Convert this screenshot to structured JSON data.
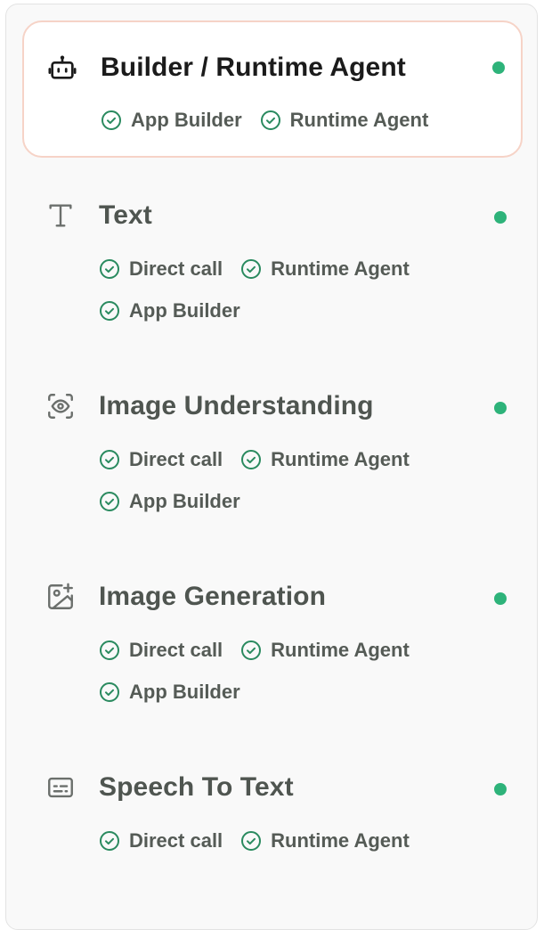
{
  "accent": "#2eb37a",
  "items": [
    {
      "title": "Builder / Runtime Agent",
      "icon": "robot-icon",
      "active": true,
      "tags": [
        "App Builder",
        "Runtime Agent"
      ]
    },
    {
      "title": "Text",
      "icon": "text-icon",
      "active": false,
      "tags": [
        "Direct call",
        "Runtime Agent",
        "App Builder"
      ]
    },
    {
      "title": "Image Understanding",
      "icon": "eye-scan-icon",
      "active": false,
      "tags": [
        "Direct call",
        "Runtime Agent",
        "App Builder"
      ]
    },
    {
      "title": "Image Generation",
      "icon": "image-plus-icon",
      "active": false,
      "tags": [
        "Direct call",
        "Runtime Agent",
        "App Builder"
      ]
    },
    {
      "title": "Speech To Text",
      "icon": "subtitles-icon",
      "active": false,
      "tags": [
        "Direct call",
        "Runtime Agent"
      ]
    }
  ]
}
